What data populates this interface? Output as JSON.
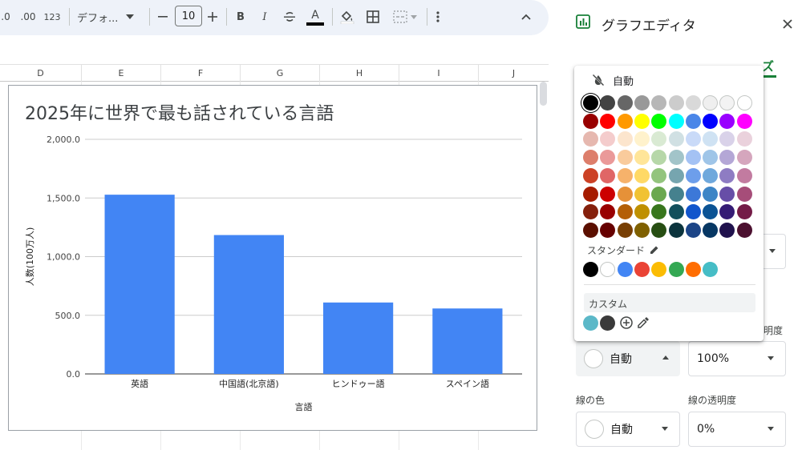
{
  "toolbar": {
    "decimal_decrease": ".0",
    "decimal_increase": ".00",
    "number_format": "123",
    "font_name": "デフォ...",
    "font_size": "10",
    "bold": "B",
    "italic": "I",
    "text_color_letter": "A"
  },
  "columns": [
    "D",
    "E",
    "F",
    "G",
    "H",
    "I",
    "J"
  ],
  "chart_data": {
    "type": "bar",
    "title": "2025年に世界で最も話されている言語",
    "categories": [
      "英語",
      "中国語(北京語)",
      "ヒンドゥー語",
      "スペイン語"
    ],
    "values": [
      1528,
      1184,
      609,
      558
    ],
    "ylabel": "人数(100万人)",
    "xlabel": "言語",
    "ylim": [
      0,
      2000
    ],
    "yticks": [
      "0.0",
      "500.0",
      "1,000.0",
      "1,500.0",
      "2,000.0"
    ],
    "bar_color": "#4285f4",
    "grid": true,
    "legend": "none"
  },
  "panel": {
    "title": "グラフエディタ",
    "tab_fragment": "ズ",
    "opacity_label_fragment": "明度",
    "fill_select_value": "自動",
    "fill_opacity_value": "100%",
    "line_color_label": "線の色",
    "line_opacity_label": "線の透明度",
    "line_color_value": "自動",
    "line_opacity_value": "0%"
  },
  "picker": {
    "auto_label": "自動",
    "standard_label": "スタンダード",
    "custom_label": "カスタム",
    "grid_colors": [
      [
        "#000000",
        "#434343",
        "#666666",
        "#999999",
        "#b7b7b7",
        "#cccccc",
        "#d9d9d9",
        "#efefef",
        "#f3f3f3",
        "#ffffff"
      ],
      [
        "#980000",
        "#ff0000",
        "#ff9900",
        "#ffff00",
        "#00ff00",
        "#00ffff",
        "#4a86e8",
        "#0000ff",
        "#9900ff",
        "#ff00ff"
      ],
      [
        "#e6b8af",
        "#f4cccc",
        "#fce5cd",
        "#fff2cc",
        "#d9ead3",
        "#d0e0e3",
        "#c9daf8",
        "#cfe2f3",
        "#d9d2e9",
        "#ead1dc"
      ],
      [
        "#dd7e6b",
        "#ea9999",
        "#f9cb9c",
        "#ffe599",
        "#b6d7a8",
        "#a2c4c9",
        "#a4c2f4",
        "#9fc5e8",
        "#b4a7d6",
        "#d5a6bd"
      ],
      [
        "#cc4125",
        "#e06666",
        "#f6b26b",
        "#ffd966",
        "#93c47d",
        "#76a5af",
        "#6d9eeb",
        "#6fa8dc",
        "#8e7cc3",
        "#c27ba0"
      ],
      [
        "#a61c00",
        "#cc0000",
        "#e69138",
        "#f1c232",
        "#6aa84f",
        "#45818e",
        "#3c78d8",
        "#3d85c6",
        "#674ea7",
        "#a64d79"
      ],
      [
        "#85200c",
        "#990000",
        "#b45f06",
        "#bf9000",
        "#38761d",
        "#134f5c",
        "#1155cc",
        "#0b5394",
        "#351c75",
        "#741b47"
      ],
      [
        "#5b0f00",
        "#660000",
        "#783f04",
        "#7f6000",
        "#274e13",
        "#0c343d",
        "#1c4587",
        "#073763",
        "#20124d",
        "#4c1130"
      ]
    ],
    "standard_colors": [
      "#000000",
      "#ffffff",
      "#4285f4",
      "#ea4335",
      "#fbbc04",
      "#34a853",
      "#ff6d01",
      "#46bdc6"
    ],
    "custom_colors": [
      "#5bb8c8",
      "#3a3a3a"
    ]
  }
}
